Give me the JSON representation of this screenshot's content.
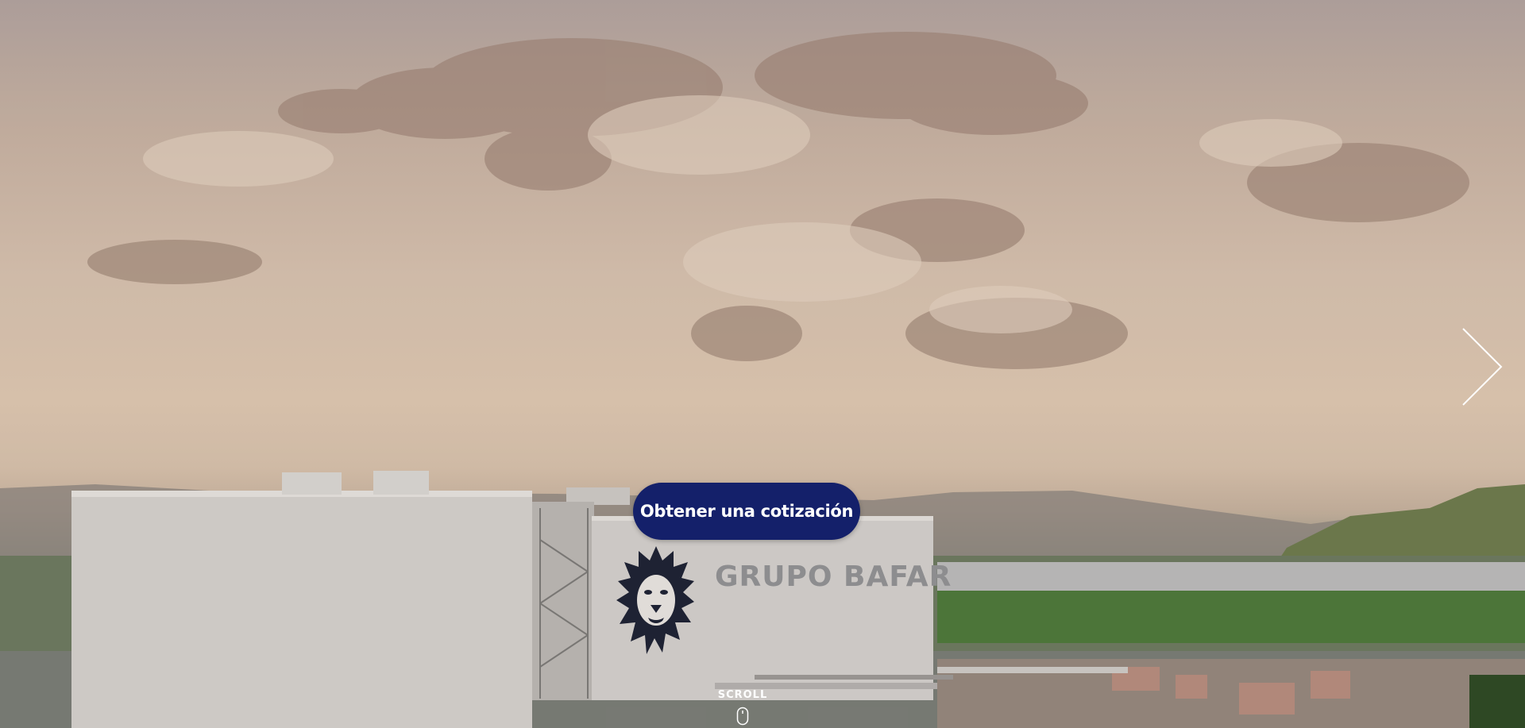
{
  "hero": {
    "cta_label": "Obtener una cotización",
    "scroll_label": "SCROLL",
    "building_sign": "GRUPO BAFAR"
  },
  "icons": {
    "next": "chevron-right-icon",
    "scroll": "mouse-icon",
    "logo": "lion-logo"
  },
  "colors": {
    "cta_background": "#14206a",
    "cta_text": "#ffffff",
    "arrow": "#ffffff"
  }
}
